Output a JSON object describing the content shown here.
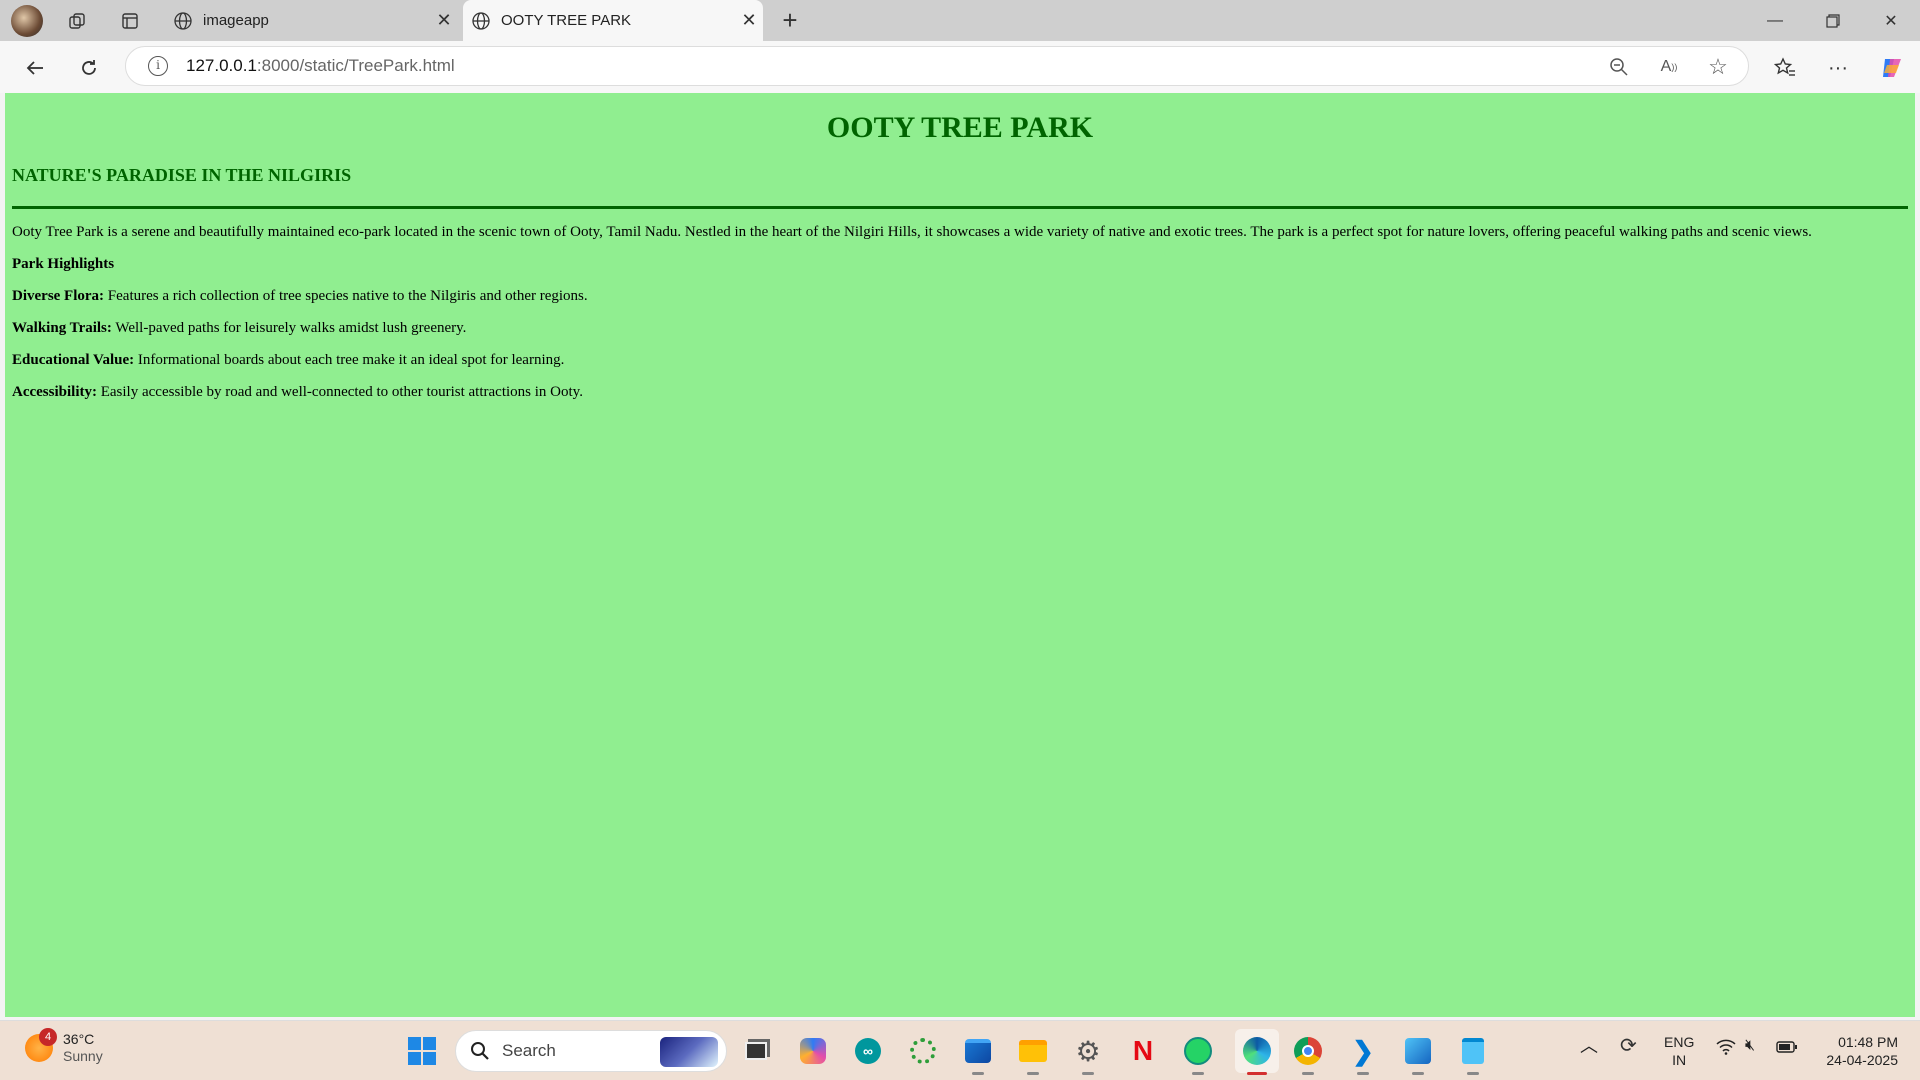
{
  "browser": {
    "tabs": [
      {
        "title": "imageapp",
        "active": false
      },
      {
        "title": "OOTY TREE PARK",
        "active": true
      }
    ],
    "url": {
      "host": "127.0.0.1",
      "path": ":8000/static/TreePark.html"
    }
  },
  "page": {
    "title": "OOTY TREE PARK",
    "subtitle": "NATURE'S PARADISE IN THE NILGIRIS",
    "intro": "Ooty Tree Park is a serene and beautifully maintained eco-park located in the scenic town of Ooty, Tamil Nadu. Nestled in the heart of the Nilgiri Hills, it showcases a wide variety of native and exotic trees. The park is a perfect spot for nature lovers, offering peaceful walking paths and scenic views.",
    "highlights_heading": "Park Highlights",
    "highlights": [
      {
        "label": "Diverse Flora:",
        "text": " Features a rich collection of tree species native to the Nilgiris and other regions."
      },
      {
        "label": "Walking Trails:",
        "text": " Well-paved paths for leisurely walks amidst lush greenery."
      },
      {
        "label": "Educational Value:",
        "text": " Informational boards about each tree make it an ideal spot for learning."
      },
      {
        "label": "Accessibility:",
        "text": " Easily accessible by road and well-connected to other tourist attractions in Ooty."
      }
    ],
    "colors": {
      "background": "#90ee90",
      "heading": "#006400"
    }
  },
  "taskbar": {
    "weather": {
      "temp": "36°C",
      "condition": "Sunny",
      "badge": "4"
    },
    "search_placeholder": "Search",
    "language": {
      "line1": "ENG",
      "line2": "IN"
    },
    "time": "01:48 PM",
    "date": "24-04-2025"
  }
}
